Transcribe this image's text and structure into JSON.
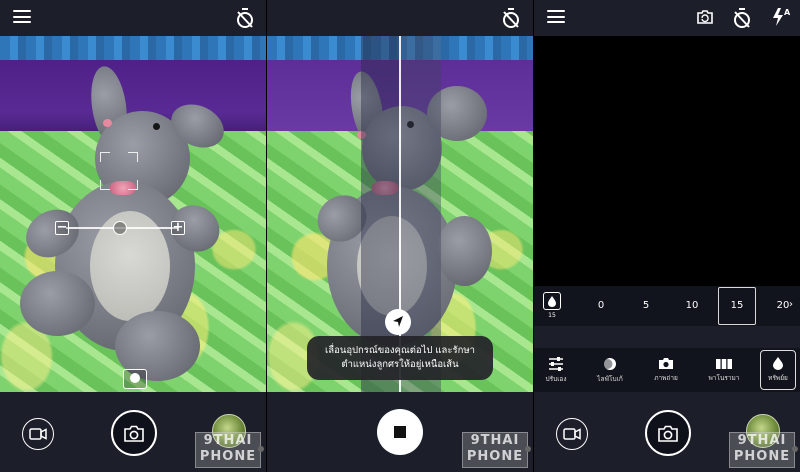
{
  "screens": [
    {
      "id": "viewfinder-exposure",
      "top_icons": [
        "menu-icon",
        "timer-off-icon"
      ],
      "exposure": {
        "minus": "−",
        "plus": "+"
      },
      "bottom": {
        "video_icon": "video-camera-icon",
        "shutter_icon": "camera-icon",
        "watermark": [
          "9THAI",
          "PHONE"
        ]
      }
    },
    {
      "id": "panorama-guide",
      "top_icons": [
        "timer-off-icon"
      ],
      "toast_line1": "เลื่อนอุปกรณ์ของคุณต่อไป และรักษา",
      "toast_line2": "ตำแหน่งลูกศรให้อยู่เหนือเส้น",
      "bottom": {
        "stop_icon": "stop-icon",
        "watermark": [
          "9THAI",
          "PHONE"
        ]
      }
    },
    {
      "id": "long-exposure-settings",
      "top_icons": [
        "menu-icon",
        "switch-camera-icon",
        "timer-off-icon",
        "flash-auto-icon"
      ],
      "indicator_value": "15",
      "values": [
        "0",
        "5",
        "10",
        "15",
        "20"
      ],
      "selected_value": "15",
      "more_arrow": "›",
      "modes": [
        {
          "label": "ปรับเอง",
          "icon": "sliders-icon"
        },
        {
          "label": "ไลฟ์โบเก้",
          "icon": "bokeh-icon"
        },
        {
          "label": "ภาพถ่าย",
          "icon": "camera-icon"
        },
        {
          "label": "พาโนรามา",
          "icon": "panorama-icon"
        },
        {
          "label": "ทรัพย์ย",
          "icon": "drop-icon"
        }
      ],
      "selected_mode": 4,
      "bottom": {
        "video_icon": "video-camera-icon",
        "shutter_icon": "camera-icon",
        "watermark": [
          "9THAI",
          "PHONE"
        ]
      }
    }
  ]
}
